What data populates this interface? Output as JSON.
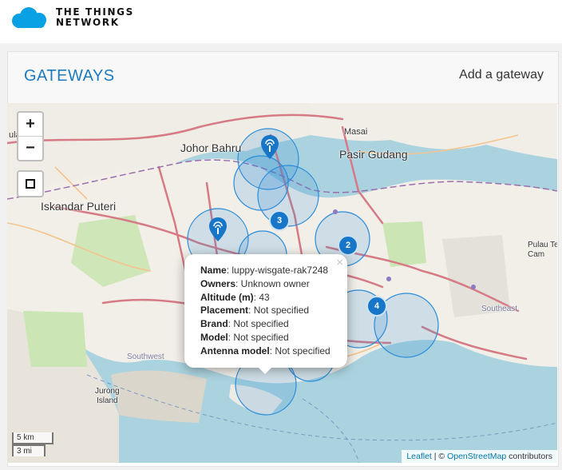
{
  "header": {
    "logo_line1": "THE THINGS",
    "logo_line2": "NETWORK"
  },
  "page": {
    "title": "GATEWAYS",
    "add_gateway": "Add a gateway"
  },
  "map": {
    "zoom_in": "+",
    "zoom_out": "−",
    "places": {
      "johor": "Johor Bahru",
      "pasir": "Pasir Gudang",
      "iskandar": "Iskandar Puteri",
      "jurong": "Jurong\nIsland",
      "southwest": "Southwest",
      "southeast": "Southeast",
      "masai": "Masai",
      "pulau": "Pulau Te\nCam",
      "ulai": "ulai"
    },
    "clusters": {
      "c3": "3",
      "c2": "2",
      "c4": "4"
    },
    "scale": {
      "km": "5 km",
      "mi": "3 mi"
    },
    "attribution": {
      "leaflet": "Leaflet",
      "sep": " | © ",
      "osm": "OpenStreetMap",
      "contrib": " contributors"
    },
    "colors": {
      "accent": "#1d7ac0",
      "marker": "#1876c8",
      "coverage": "#2a8cd8"
    }
  },
  "popup": {
    "close": "×",
    "rows": [
      {
        "label": "Name",
        "value": ": luppy-wisgate-rak7248"
      },
      {
        "label": "Owners",
        "value": ": Unknown owner"
      },
      {
        "label": "Altitude (m)",
        "value": ": 43"
      },
      {
        "label": "Placement",
        "value": ": Not specified"
      },
      {
        "label": "Brand",
        "value": ": Not specified"
      },
      {
        "label": "Model",
        "value": ": Not specified"
      },
      {
        "label": "Antenna model",
        "value": ": Not specified"
      }
    ]
  }
}
